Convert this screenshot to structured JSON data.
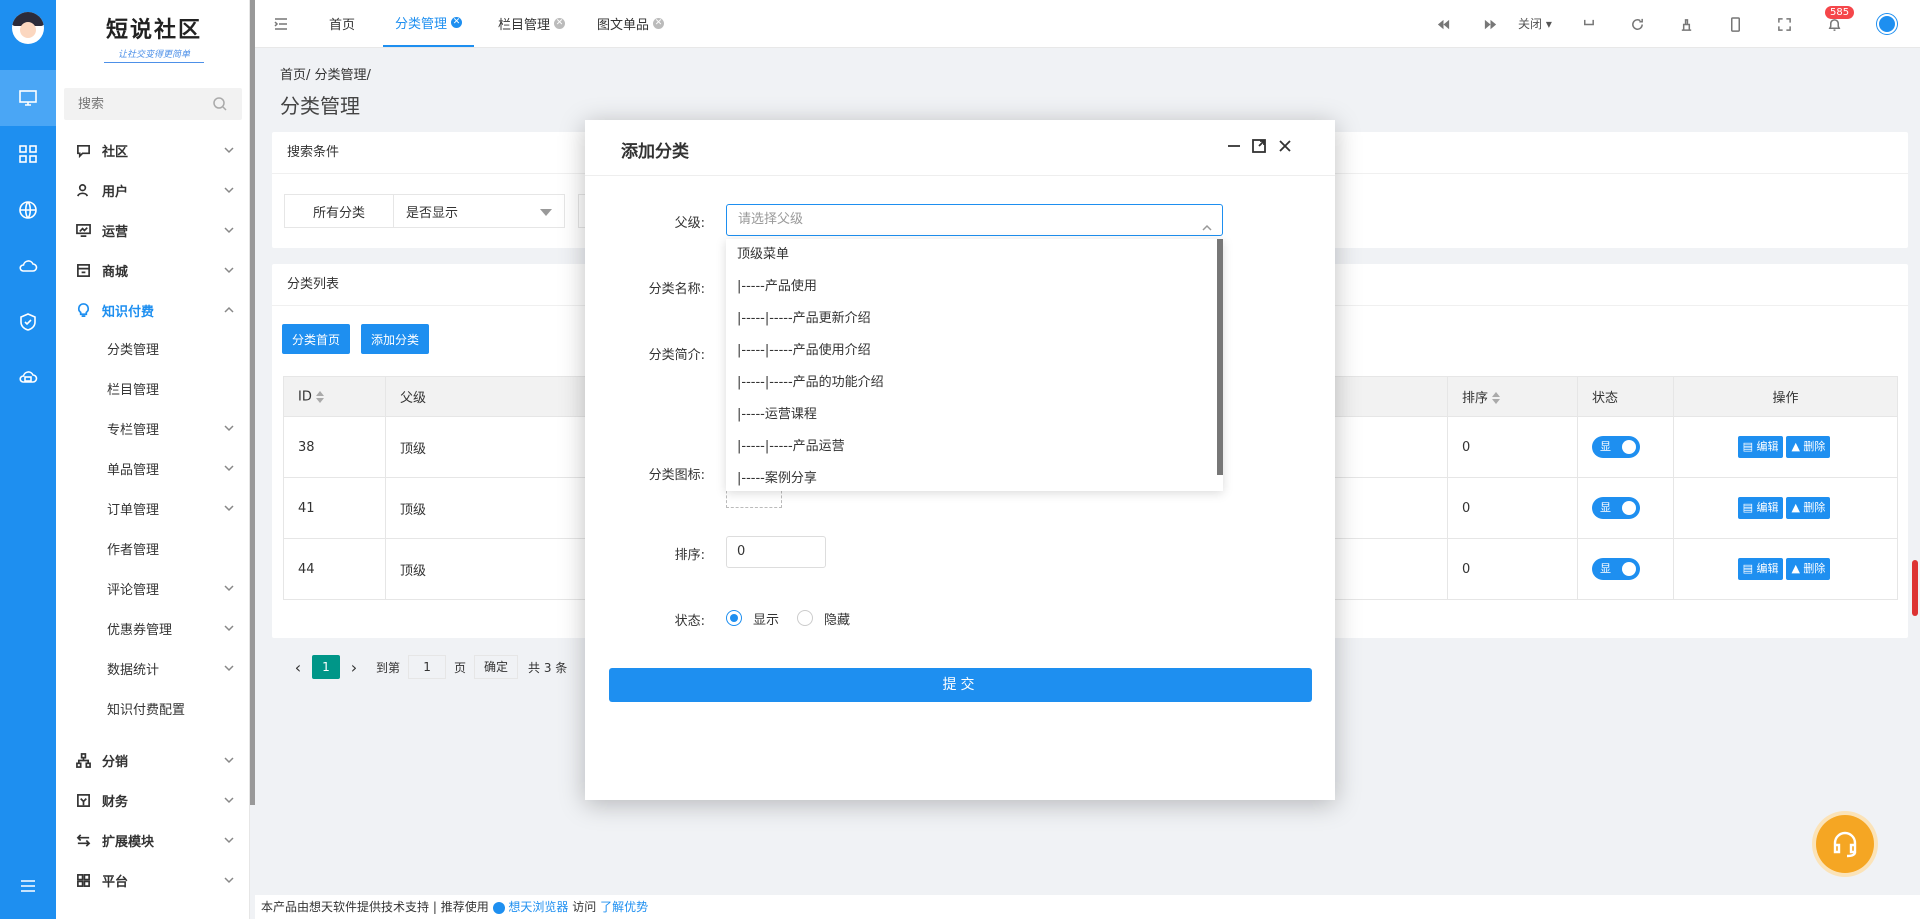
{
  "logo": {
    "title": "短说社区",
    "subtitle": "让社交变得更简单"
  },
  "search": {
    "placeholder": "搜索"
  },
  "menu": [
    {
      "label": "社区",
      "icon": "chat-icon"
    },
    {
      "label": "用户",
      "icon": "user-icon"
    },
    {
      "label": "运营",
      "icon": "monitor-chart-icon"
    },
    {
      "label": "商城",
      "icon": "store-icon"
    },
    {
      "label": "知识付费",
      "icon": "bulb-icon"
    },
    {
      "label": "分销",
      "icon": "org-icon"
    },
    {
      "label": "财务",
      "icon": "wallet-icon"
    },
    {
      "label": "扩展模块",
      "icon": "extend-icon"
    },
    {
      "label": "平台",
      "icon": "platform-icon"
    }
  ],
  "submenu": [
    "分类管理",
    "栏目管理",
    "专栏管理",
    "单品管理",
    "订单管理",
    "作者管理",
    "评论管理",
    "优惠券管理",
    "数据统计",
    "知识付费配置"
  ],
  "tabs": [
    {
      "label": "首页"
    },
    {
      "label": "分类管理"
    },
    {
      "label": "栏目管理"
    },
    {
      "label": "图文单品"
    }
  ],
  "topbar": {
    "close_label": "关闭",
    "notifications": "585"
  },
  "breadcrumb": "首页/ 分类管理/",
  "page_title": "分类管理",
  "search_card": {
    "title": "搜索条件",
    "filter1": "所有分类",
    "filter2": "是否显示"
  },
  "list_card": {
    "title": "分类列表",
    "btn_home": "分类首页",
    "btn_add": "添加分类"
  },
  "table": {
    "headers": {
      "id": "ID",
      "parent": "父级",
      "sort": "排序",
      "status": "状态",
      "ops": "操作"
    },
    "rows": [
      {
        "id": "38",
        "parent": "顶级",
        "sort": "0",
        "status": "显"
      },
      {
        "id": "41",
        "parent": "顶级",
        "sort": "0",
        "status": "显"
      },
      {
        "id": "44",
        "parent": "顶级",
        "sort": "0",
        "status": "显"
      }
    ],
    "edit_label": "编辑",
    "delete_label": "删除"
  },
  "pager": {
    "page": "1",
    "goto": "到第",
    "goto_value": "1",
    "page_unit": "页",
    "confirm": "确定",
    "total": "共 3 条"
  },
  "modal": {
    "title": "添加分类",
    "labels": {
      "parent": "父级:",
      "name": "分类名称:",
      "intro": "分类简介:",
      "icon": "分类图标:",
      "sort": "排序:",
      "status": "状态:"
    },
    "parent_placeholder": "请选择父级",
    "dropdown": [
      "顶级菜单",
      "|-----产品使用",
      "|-----|-----产品更新介绍",
      "|-----|-----产品使用介绍",
      "|-----|-----产品的功能介绍",
      "|-----运营课程",
      "|-----|-----产品运营",
      "|-----案例分享"
    ],
    "sort_value": "0",
    "status_show": "显示",
    "status_hide": "隐藏",
    "submit": "提交"
  },
  "footer": {
    "text1": "本产品由想天软件提供技术支持",
    "sep": "|",
    "text2": "推荐使用",
    "browser": "想天浏览器",
    "text3": "访问",
    "link": "了解优势"
  },
  "colors": {
    "primary": "#1e8ff0",
    "badge": "#f5464a",
    "help": "#f5a623"
  }
}
